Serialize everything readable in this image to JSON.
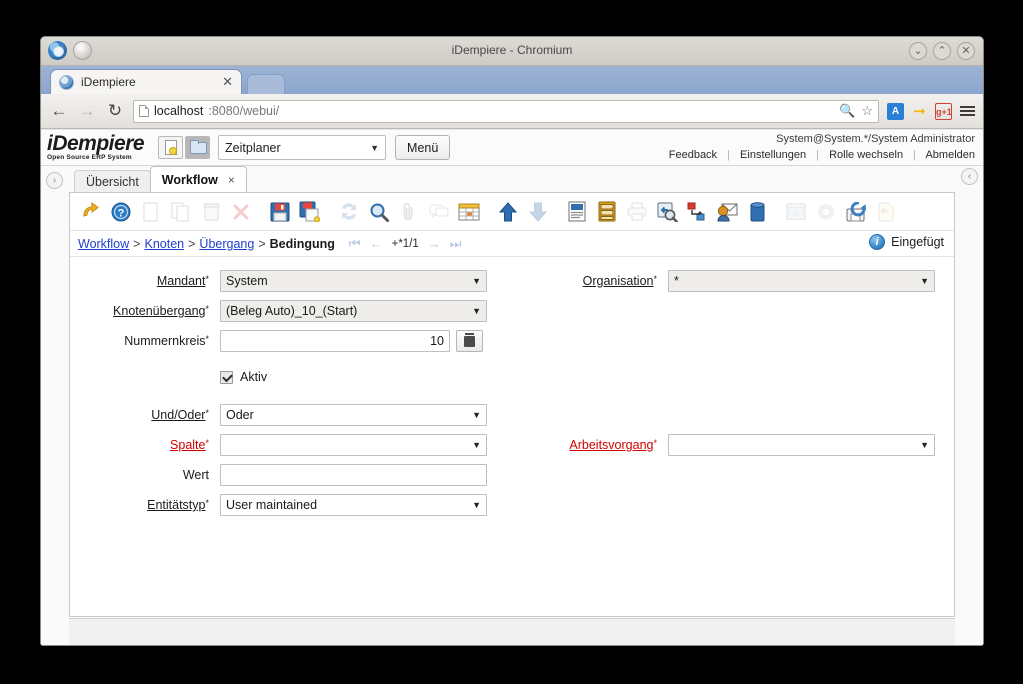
{
  "window": {
    "title": "iDempiere - Chromium",
    "minimize_label": "⌄",
    "maximize_label": "⌃",
    "close_label": "✕"
  },
  "browser": {
    "tab": {
      "title": "iDempiere",
      "close_label": "✕"
    },
    "nav": {
      "back": "←",
      "forward": "→",
      "reload": "↻"
    },
    "url": {
      "host": "localhost",
      "rest": ":8080/webui/"
    },
    "omnibox_icons": [
      "zoom-icon",
      "star-icon"
    ],
    "extensions": [
      {
        "name": "translate-extension",
        "label": "A"
      },
      {
        "name": "mobile-extension",
        "label": "→"
      },
      {
        "name": "google-plus-one-extension",
        "label": "g+1"
      }
    ],
    "menu_label": "menu"
  },
  "app": {
    "logo": {
      "line1": "iDempiere",
      "line2": "Open Source  ERP System"
    },
    "quick_buttons": [
      {
        "name": "new-document-button",
        "icon": "new-document-icon"
      },
      {
        "name": "open-folder-button",
        "icon": "folder-icon"
      }
    ],
    "role_select": {
      "value": "Zeitplaner",
      "caret": "▼"
    },
    "menu_button": "Menü",
    "user_info": "System@System.*/System Administrator",
    "user_links": [
      "Feedback",
      "Einstellungen",
      "Rolle wechseln",
      "Abmelden"
    ],
    "link_separator": "|",
    "side_handles": {
      "left": "›",
      "right": "‹"
    }
  },
  "window_tabs": [
    {
      "label": "Übersicht",
      "active": false,
      "closable": false
    },
    {
      "label": "Workflow",
      "active": true,
      "closable": true,
      "close_label": "×"
    }
  ],
  "toolbar": {
    "items": [
      {
        "name": "undo-button",
        "icon": "undo-arrow-icon",
        "enabled": true
      },
      {
        "name": "help-button",
        "icon": "help-question-icon",
        "enabled": true
      },
      {
        "name": "new-record-button",
        "icon": "new-record-icon",
        "enabled": false
      },
      {
        "name": "copy-record-button",
        "icon": "copy-record-icon",
        "enabled": false
      },
      {
        "name": "delete-record-button",
        "icon": "trash-icon",
        "enabled": false
      },
      {
        "name": "delete-selection-button",
        "icon": "red-x-icon",
        "enabled": false
      },
      {
        "name": "save-button",
        "icon": "floppy-save-icon",
        "enabled": true
      },
      {
        "name": "save-create-button",
        "icon": "floppy-save-new-icon",
        "enabled": true
      },
      {
        "name": "refresh-button",
        "icon": "refresh-arrows-icon",
        "enabled": false
      },
      {
        "name": "find-button",
        "icon": "magnifier-icon",
        "enabled": true
      },
      {
        "name": "attachment-button",
        "icon": "paperclip-icon",
        "enabled": false
      },
      {
        "name": "chat-button",
        "icon": "chat-bubbles-icon",
        "enabled": false
      },
      {
        "name": "grid-toggle-button",
        "icon": "grid-table-icon",
        "enabled": true
      },
      {
        "name": "parent-record-button",
        "icon": "blue-arrow-up-icon",
        "enabled": true
      },
      {
        "name": "detail-record-button",
        "icon": "blue-arrow-down-icon",
        "enabled": false
      },
      {
        "name": "report-button",
        "icon": "report-document-icon",
        "enabled": true
      },
      {
        "name": "archive-button",
        "icon": "archive-drawer-icon",
        "enabled": true
      },
      {
        "name": "print-button",
        "icon": "printer-icon",
        "enabled": false
      },
      {
        "name": "zoom-across-button",
        "icon": "zoom-back-icon",
        "enabled": true
      },
      {
        "name": "active-workflow-button",
        "icon": "workflow-node-icon",
        "enabled": true
      },
      {
        "name": "request-button",
        "icon": "request-envelope-icon",
        "enabled": true
      },
      {
        "name": "product-info-button",
        "icon": "blue-box-icon",
        "enabled": true
      },
      {
        "name": "customize-button",
        "icon": "window-layout-icon",
        "enabled": false
      },
      {
        "name": "preference-button",
        "icon": "gear-icon",
        "enabled": false
      },
      {
        "name": "export-button",
        "icon": "export-disk-icon",
        "enabled": true
      },
      {
        "name": "import-button",
        "icon": "import-page-icon",
        "enabled": false
      }
    ]
  },
  "breadcrumb": {
    "links": [
      "Workflow",
      "Knoten",
      "Übergang"
    ],
    "current": "Bedingung",
    "separator": ">",
    "pager": {
      "first": "⏮",
      "prev": "←",
      "count": "+*1/1",
      "next": "→",
      "last": "⏭"
    },
    "status": {
      "icon": "info-icon",
      "label": "Eingefügt"
    }
  },
  "form": {
    "rows": [
      {
        "left": {
          "label": "Mandant",
          "required": true,
          "link_style": true,
          "control": "select",
          "value": "System",
          "readonly": true,
          "field_name": "mandant-select"
        },
        "right": {
          "label": "Organisation",
          "required": true,
          "link_style": true,
          "control": "select",
          "value": "*",
          "readonly": true,
          "field_name": "organisation-select"
        }
      },
      {
        "left": {
          "label": "Knotenübergang",
          "required": true,
          "link_style": true,
          "control": "select",
          "value": "(Beleg Auto)_10_(Start)",
          "readonly": true,
          "field_name": "knotenuebergang-select"
        },
        "right": null
      },
      {
        "left": {
          "label": "Nummernkreis",
          "required": true,
          "link_style": false,
          "control": "number",
          "value": "10",
          "readonly": false,
          "field_name": "nummernkreis-input",
          "side_button": {
            "name": "nummernkreis-clear-button",
            "icon": "trash-icon"
          }
        },
        "right": null
      },
      {
        "left": {
          "label": "",
          "required": false,
          "link_style": false,
          "control": "checkbox",
          "value": "Aktiv",
          "checked": true,
          "field_name": "aktiv-checkbox"
        },
        "right": null
      },
      {
        "left": {
          "label": "Und/Oder",
          "required": true,
          "link_style": true,
          "control": "select",
          "value": "Oder",
          "readonly": false,
          "field_name": "und-oder-select"
        },
        "right": null
      },
      {
        "left": {
          "label": "Spalte",
          "required": true,
          "link_style": true,
          "error": true,
          "control": "select",
          "value": "",
          "readonly": false,
          "field_name": "spalte-select"
        },
        "right": {
          "label": "Arbeitsvorgang",
          "required": true,
          "link_style": true,
          "error": true,
          "control": "select",
          "value": "",
          "readonly": false,
          "field_name": "arbeitsvorgang-select"
        }
      },
      {
        "left": {
          "label": "Wert",
          "required": false,
          "link_style": false,
          "control": "text",
          "value": "",
          "readonly": false,
          "field_name": "wert-input"
        },
        "right": null
      },
      {
        "left": {
          "label": "Entitätstyp",
          "required": true,
          "link_style": true,
          "control": "select",
          "value": "User maintained",
          "readonly": false,
          "field_name": "entitaetstyp-select"
        },
        "right": null
      }
    ],
    "caret": "▼",
    "required_marker": "*"
  },
  "colors": {
    "link": "#1d3fd0",
    "error": "#d20000",
    "tabstrip": "#8ba5cc",
    "accent_blue": "#2b7cc4"
  }
}
